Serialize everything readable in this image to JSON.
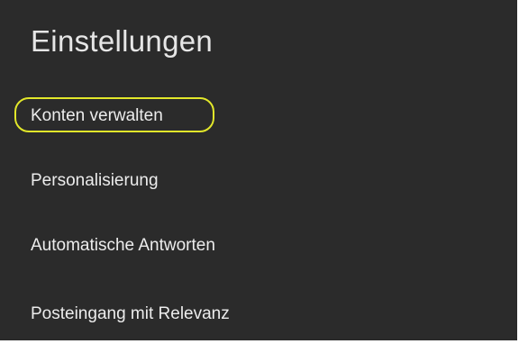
{
  "settings": {
    "title": "Einstellungen",
    "items": [
      {
        "label": "Konten verwalten"
      },
      {
        "label": "Personalisierung"
      },
      {
        "label": "Automatische Antworten"
      },
      {
        "label": "Posteingang mit Relevanz"
      }
    ]
  },
  "colors": {
    "panel_background": "#2b2b2b",
    "text": "#ececec",
    "highlight": "#e2e72a"
  }
}
